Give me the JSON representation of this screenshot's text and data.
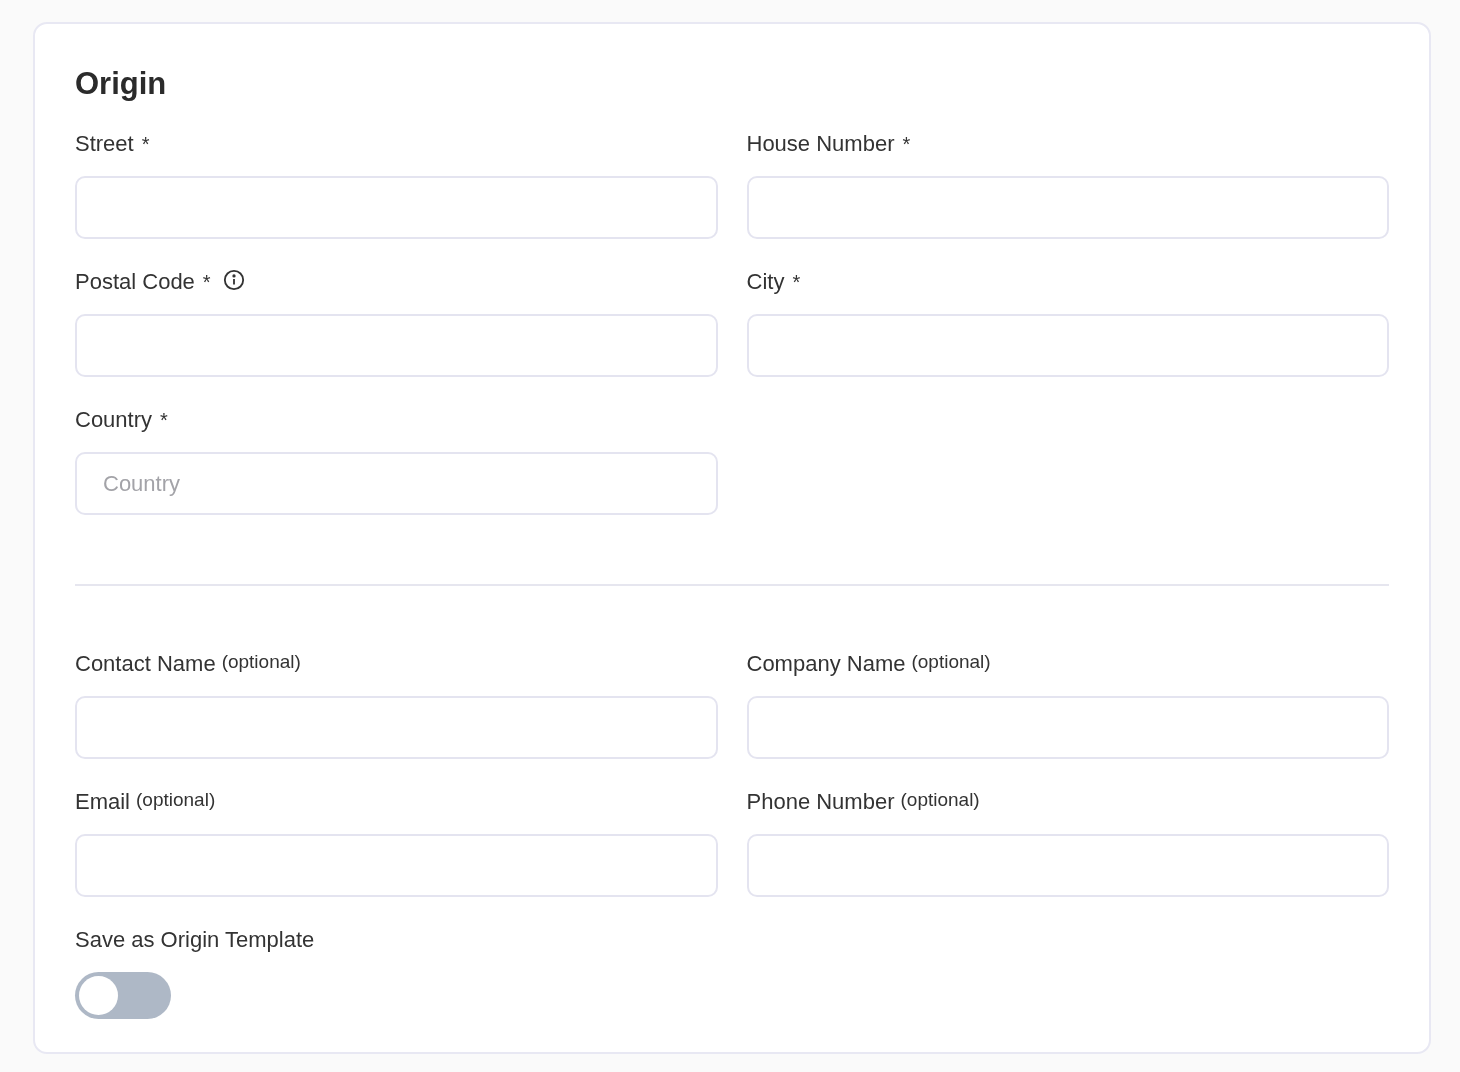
{
  "origin": {
    "title": "Origin",
    "address_fields": [
      {
        "label": "Street",
        "marker": "*"
      },
      {
        "label": "House Number",
        "marker": "*"
      },
      {
        "label": "Postal Code",
        "marker": "*",
        "info": true
      },
      {
        "label": "City",
        "marker": "*"
      },
      {
        "label": "Country",
        "marker": "*",
        "placeholder": "Country"
      }
    ],
    "contact_fields": [
      {
        "label": "Contact Name",
        "note": "(optional)"
      },
      {
        "label": "Company Name",
        "note": "(optional)"
      },
      {
        "label": "Email",
        "note": "(optional)"
      },
      {
        "label": "Phone Number",
        "note": "(optional)"
      }
    ],
    "template_toggle": {
      "label": "Save as Origin Template",
      "on": false
    }
  }
}
